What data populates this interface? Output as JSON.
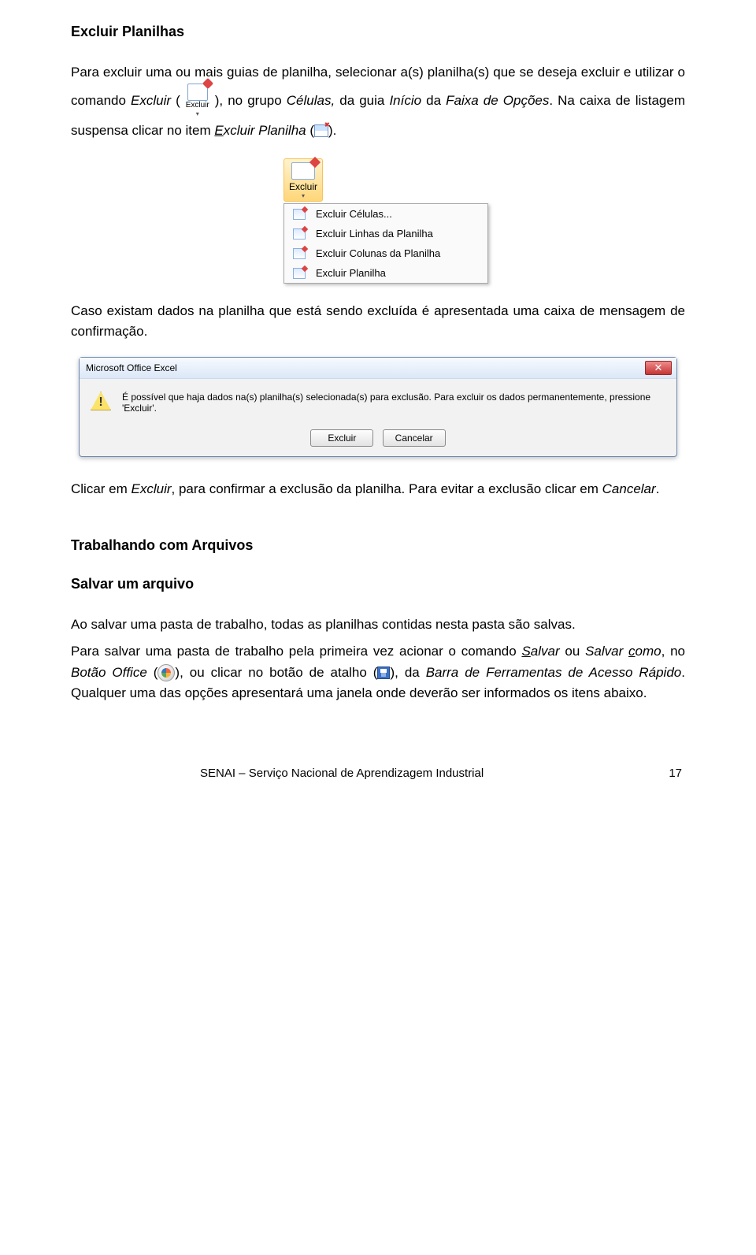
{
  "h_excluir_planilhas": "Excluir Planilhas",
  "p1_a": "Para excluir uma ou mais guias de planilha, selecionar a(s) planilha(s) que se deseja",
  "p1_b": "excluir e utilizar o comando ",
  "p1_em_excluir": "Excluir",
  "p1_c": " (",
  "p1_d": "), no grupo ",
  "p1_em_celulas": "Células,",
  "p1_e": " da guia ",
  "p1_em_inicio": "Início",
  "p1_f": " da ",
  "p1_em_faixa": "Faixa de Opções",
  "p1_g": ". Na caixa de listagem suspensa clicar no item ",
  "p1_em_excluir_planilha": "Excluir Planilha",
  "p1_h": " (",
  "p1_i": ").",
  "dd_button_label": "Excluir",
  "dd_items": [
    "Excluir Células...",
    "Excluir Linhas da Planilha",
    "Excluir Colunas da Planilha",
    "Excluir Planilha"
  ],
  "p2": "Caso existam dados na planilha que está sendo excluída é apresentada uma caixa de mensagem de confirmação.",
  "dialog_title": "Microsoft Office Excel",
  "dialog_msg": "É possível que haja dados na(s) planilha(s) selecionada(s) para exclusão. Para excluir os dados permanentemente, pressione 'Excluir'.",
  "dialog_btn_ok": "Excluir",
  "dialog_btn_cancel": "Cancelar",
  "p3_a": "Clicar em ",
  "p3_em1": "Excluir",
  "p3_b": ", para confirmar a exclusão da planilha. Para evitar a exclusão clicar em ",
  "p3_em2": "Cancelar",
  "p3_c": ".",
  "h_trab": "Trabalhando com Arquivos",
  "h_salvar": "Salvar um arquivo",
  "p4": "Ao salvar uma pasta de trabalho, todas as planilhas contidas nesta pasta são salvas.",
  "p5_a": "Para salvar uma pasta de trabalho pela primeira vez acionar o comando ",
  "p5_salvar": "Salvar",
  "p5_b": " ou ",
  "p5_salvar_como": "Salvar como",
  "p5_c": ", no ",
  "p5_botao": "Botão Office",
  "p5_d": " (",
  "p5_e": "), ou clicar no botão de atalho (",
  "p5_f": "), da ",
  "p5_barra": "Barra de Ferramentas de Acesso Rápido",
  "p5_g": ". Qualquer uma das opções apresentará uma janela onde deverão ser informados os itens abaixo.",
  "footer_text": "SENAI – Serviço Nacional de Aprendizagem Industrial",
  "page_num": "17"
}
